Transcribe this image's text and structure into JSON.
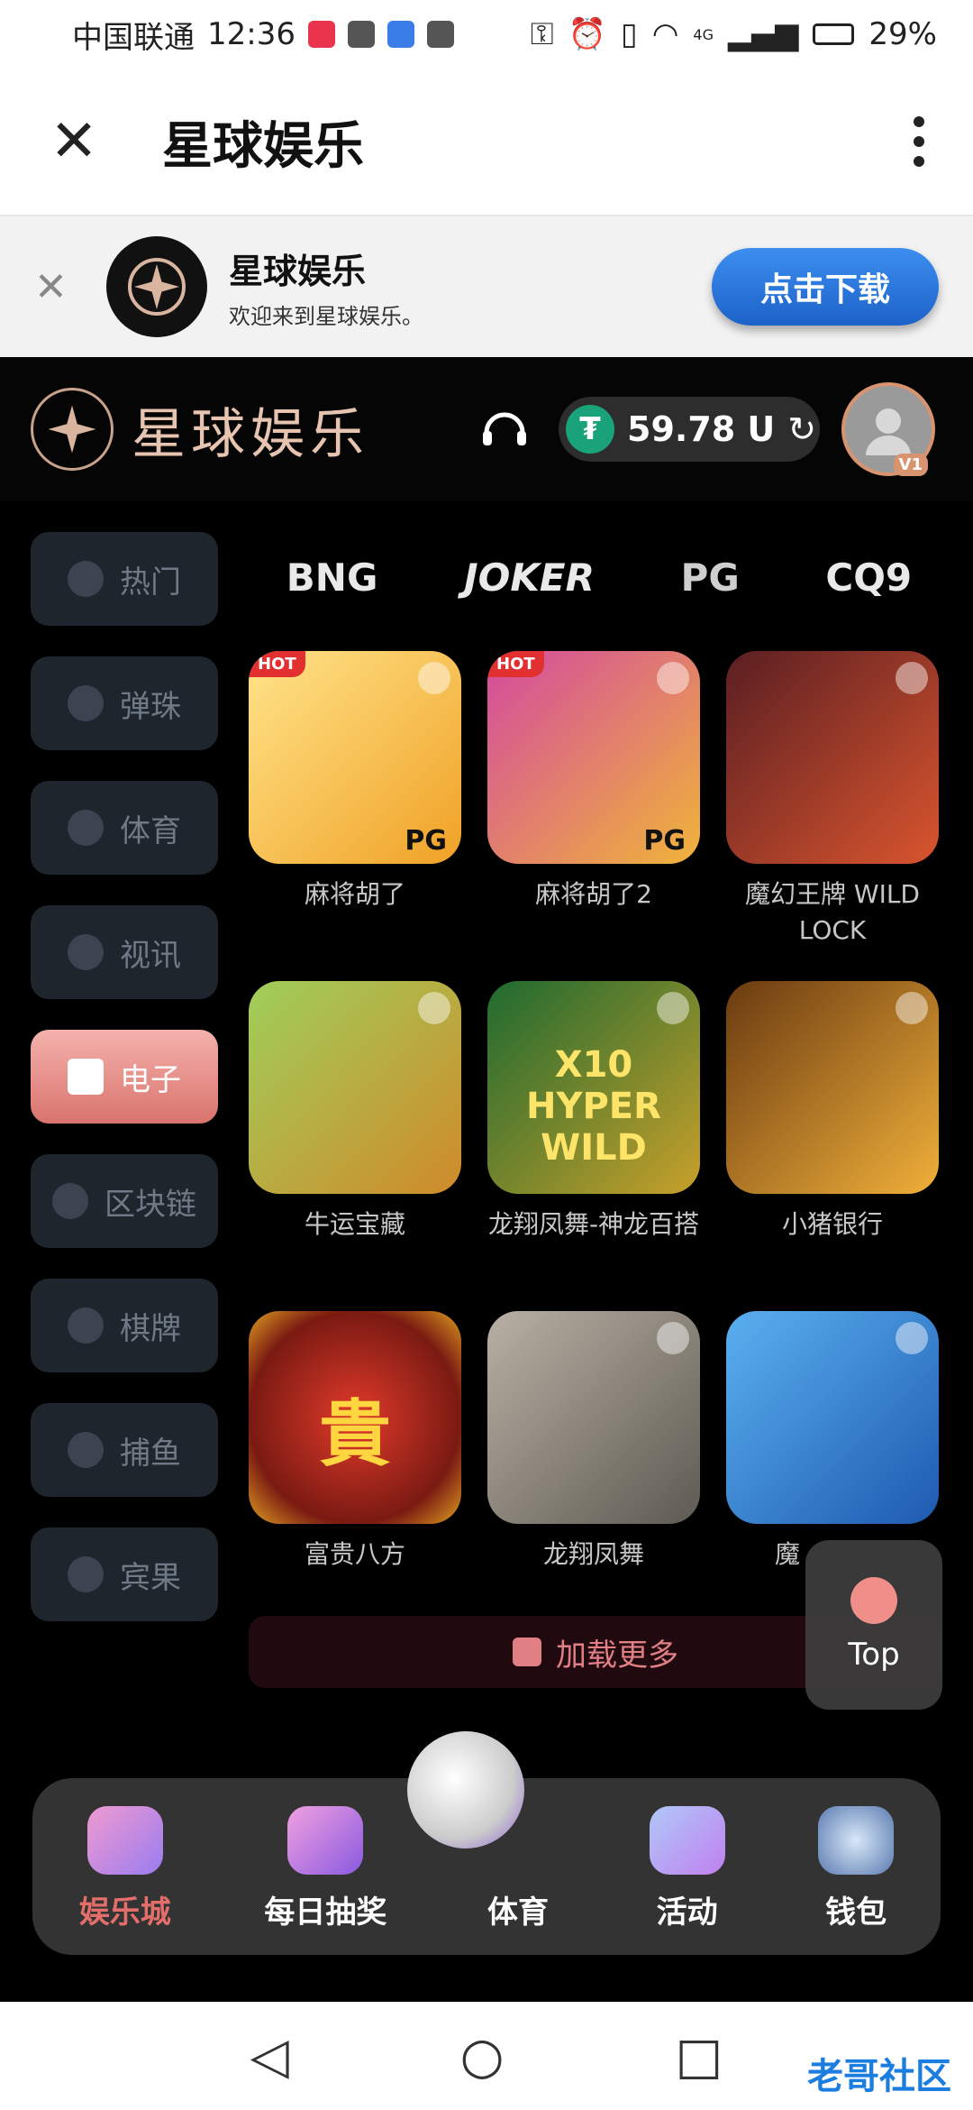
{
  "statusbar": {
    "carrier": "中国联通",
    "time": "12:36",
    "battery": "29%",
    "net": "4G"
  },
  "appbar": {
    "title": "星球娱乐",
    "close_icon": "close-icon",
    "more_icon": "more-vert-icon"
  },
  "banner": {
    "title": "星球娱乐",
    "subtitle": "欢迎来到星球娱乐。",
    "download": "点击下载"
  },
  "header": {
    "brand": "星球娱乐",
    "balance_symbol": "₮",
    "balance": "59.78 U",
    "vip": "V1"
  },
  "sidebar": {
    "items": [
      {
        "label": "热门",
        "icon": "fire-icon"
      },
      {
        "label": "弹珠",
        "icon": "pinball-icon"
      },
      {
        "label": "体育",
        "icon": "soccer-icon"
      },
      {
        "label": "视讯",
        "icon": "dealer-icon"
      },
      {
        "label": "电子",
        "icon": "slot-icon",
        "active": true
      },
      {
        "label": "区块链",
        "icon": "blockchain-icon"
      },
      {
        "label": "棋牌",
        "icon": "cards-icon"
      },
      {
        "label": "捕鱼",
        "icon": "fish-icon"
      },
      {
        "label": "宾果",
        "icon": "bingo-icon"
      }
    ]
  },
  "providers": [
    "BNG",
    "JOKER",
    "PG",
    "CQ9"
  ],
  "games": [
    {
      "title": "麻将胡了",
      "hot": "HOT",
      "badge": "PG",
      "color": "#f4c23a"
    },
    {
      "title": "麻将胡了2",
      "hot": "HOT",
      "badge": "PG",
      "color": "#e8a83a"
    },
    {
      "title": "魔幻王牌 WILD LOCK",
      "color": "#b9442c"
    },
    {
      "title": "牛运宝藏",
      "color": "#8ab74a"
    },
    {
      "title": "龙翔凤舞-神龙百搭",
      "color": "#2f7b3c"
    },
    {
      "title": "小猪银行",
      "color": "#e0a02a"
    },
    {
      "title": "富贵八方",
      "color": "#c0261e"
    },
    {
      "title": "龙翔凤舞",
      "color": "#8c8a86"
    },
    {
      "title": "魔",
      "color": "#3c8ed6"
    }
  ],
  "load_more": "加载更多",
  "top_button": "Top",
  "bottom_nav": [
    {
      "label": "娱乐城",
      "active": true
    },
    {
      "label": "每日抽奖"
    },
    {
      "label": "体育"
    },
    {
      "label": "活动"
    },
    {
      "label": "钱包"
    }
  ],
  "watermark": "老哥社区"
}
